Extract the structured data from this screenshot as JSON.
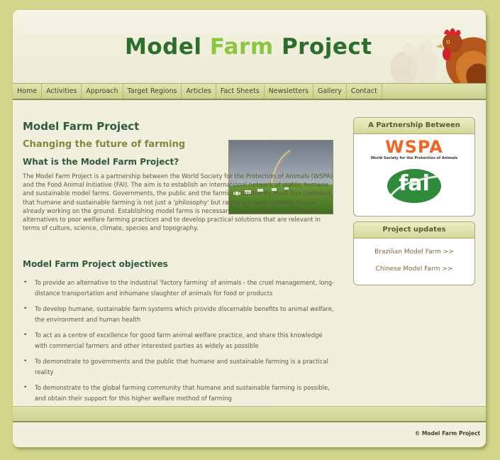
{
  "header": {
    "logo_part1": "Model ",
    "logo_part2": "Farm",
    "logo_part3": " Project"
  },
  "nav": {
    "items": [
      "Home",
      "Activities",
      "Approach",
      "Target Regions",
      "Articles",
      "Fact Sheets",
      "Newsletters",
      "Gallery",
      "Contact"
    ]
  },
  "main": {
    "title": "Model Farm Project",
    "subtitle": "Changing the future of farming",
    "what_heading": "What is the Model Farm Project?",
    "intro": "The Model Farm Project is a partnership between the World Society for the Protection of Animals (WSPA) and the Food Animal Initiative (FAI). The aim is to establish an international network of viable, humane and sustainable model farms. Governments, the public and the farming community must feel confident that humane and sustainable farming is not just a 'philosophy' but rather a practical reality that is already working on the ground. Establishing model farms is necessary to demonstrate real humane alternatives to poor welfare farming practices and to develop practical solutions that are relevant in terms of culture, science, climate, species and topography.",
    "objectives_heading": "Model Farm Project objectives",
    "objectives": [
      "To provide an alternative to the industrial 'factory farming' of animals - the cruel management, long-distance transportation and inhumane slaughter of animals for food or products",
      "To develop humane, sustainable farm systems which provide discernable benefits to animal welfare, the environment and human health",
      "To act as a centre of excellence for good farm animal welfare practice, and share this knowledge with commercial farmers and other interested parties as widely as possible",
      "To demonstrate to governments and the public that humane and sustainable farming is a practical reality",
      "To demonstrate to the global farming community that humane and sustainable farming is possible, and obtain their support for this higher welfare method of farming"
    ]
  },
  "sidebar": {
    "partnership_heading": "A Partnership Between",
    "wspa_logo": "WSPA",
    "wspa_tagline": "World Society for the Protection of Animals",
    "fai_logo": "fai",
    "updates_heading": "Project updates",
    "updates": [
      "Brazilian Model Farm >>",
      "Chinese Model Farm >>"
    ]
  },
  "footer": {
    "copyright": "© Model Farm Project"
  },
  "colors": {
    "background": "#d2d58a",
    "page": "#f1f0df",
    "heading_green": "#2f5a3c",
    "logo_dark_green": "#2c6f2a",
    "logo_light_green": "#8cc63e",
    "wspa_orange": "#f26522",
    "fai_green": "#2e8b3a"
  }
}
